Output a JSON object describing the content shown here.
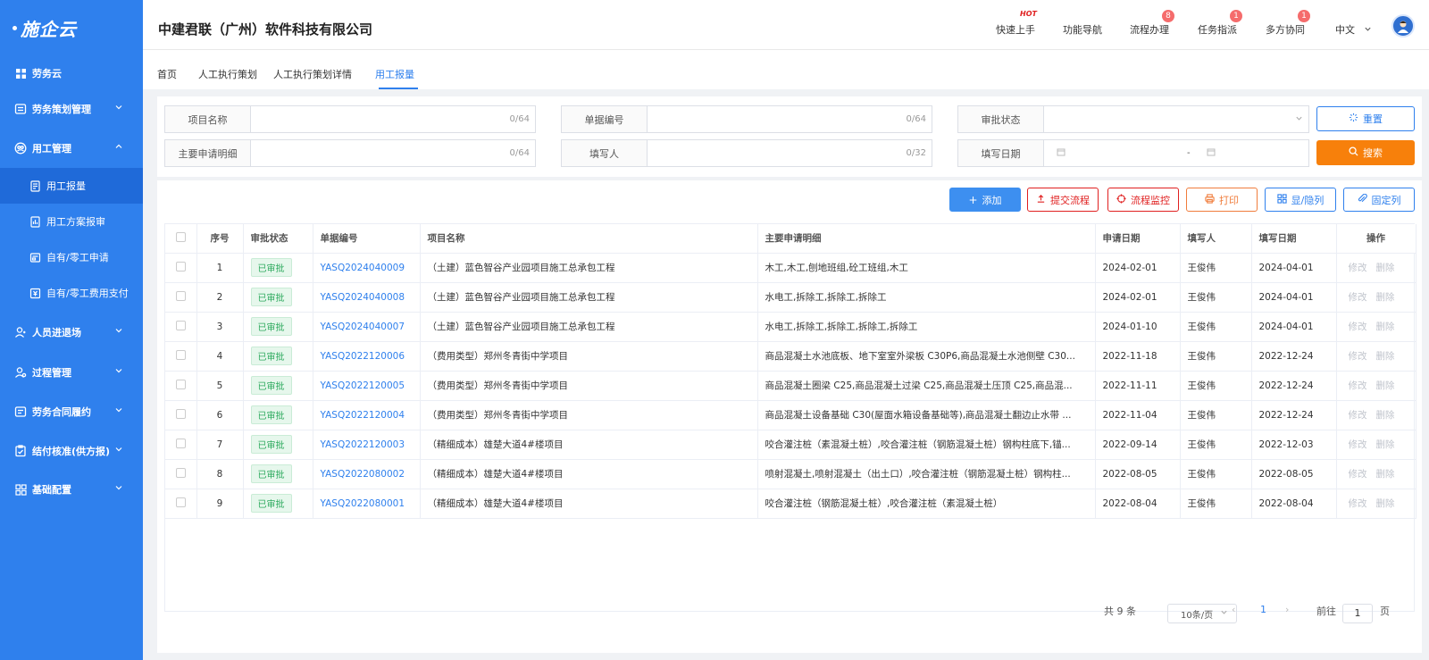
{
  "app": {
    "logo": "施企云"
  },
  "sidebar": {
    "items": [
      {
        "label": "劳务云"
      },
      {
        "label": "劳务策划管理"
      },
      {
        "label": "用工管理"
      },
      {
        "label": "用工报量"
      },
      {
        "label": "用工方案报审"
      },
      {
        "label": "自有/零工申请"
      },
      {
        "label": "自有/零工费用支付"
      },
      {
        "label": "人员进退场"
      },
      {
        "label": "过程管理"
      },
      {
        "label": "劳务合同履约"
      },
      {
        "label": "结付核准(供方报)"
      },
      {
        "label": "基础配置"
      }
    ]
  },
  "header": {
    "company": "中建君联（广州）软件科技有限公司",
    "nav": [
      {
        "label": "快速上手",
        "hot": "HOT"
      },
      {
        "label": "功能导航"
      },
      {
        "label": "流程办理",
        "badge": "8"
      },
      {
        "label": "任务指派",
        "badge": "1"
      },
      {
        "label": "多方协同",
        "badge": "1"
      }
    ],
    "language": "中文"
  },
  "tabs": [
    "首页",
    "人工执行策划",
    "人工执行策划详情",
    "用工报量"
  ],
  "filter": {
    "fields": [
      {
        "label": "项目名称",
        "counter": "0/64"
      },
      {
        "label": "单据编号",
        "counter": "0/64"
      },
      {
        "label": "审批状态",
        "counter": ""
      },
      {
        "label": "主要申请明细",
        "counter": "0/64"
      },
      {
        "label": "填写人",
        "counter": "0/32"
      },
      {
        "label": "填写日期",
        "counter": ""
      }
    ],
    "date_separator": "-",
    "reset_label": "重置",
    "search_label": "搜索"
  },
  "toolbar": {
    "add": "添加",
    "submit": "提交流程",
    "monitor": "流程监控",
    "print": "打印",
    "toggle": "显/隐列",
    "fix": "固定列"
  },
  "table": {
    "columns": [
      "",
      "序号",
      "审批状态",
      "单据编号",
      "项目名称",
      "主要申请明细",
      "申请日期",
      "填写人",
      "填写日期",
      "操作"
    ],
    "rows": [
      {
        "no": "1",
        "status": "已审批",
        "code": "YASQ2024040009",
        "project": "（土建）蓝色智谷产业园项目施工总承包工程",
        "detail": "木工,木工,刨地班组,砼工班组,木工",
        "apply_date": "2024-02-01",
        "user": "王俊伟",
        "fill_date": "2024-04-01"
      },
      {
        "no": "2",
        "status": "已审批",
        "code": "YASQ2024040008",
        "project": "（土建）蓝色智谷产业园项目施工总承包工程",
        "detail": "水电工,拆除工,拆除工,拆除工",
        "apply_date": "2024-02-01",
        "user": "王俊伟",
        "fill_date": "2024-04-01"
      },
      {
        "no": "3",
        "status": "已审批",
        "code": "YASQ2024040007",
        "project": "（土建）蓝色智谷产业园项目施工总承包工程",
        "detail": "水电工,拆除工,拆除工,拆除工,拆除工",
        "apply_date": "2024-01-10",
        "user": "王俊伟",
        "fill_date": "2024-04-01"
      },
      {
        "no": "4",
        "status": "已审批",
        "code": "YASQ2022120006",
        "project": "（费用类型）郑州冬青街中学项目",
        "detail": "商品混凝土水池底板、地下室室外梁板 C30P6,商品混凝土水池侧壁 C30...",
        "apply_date": "2022-11-18",
        "user": "王俊伟",
        "fill_date": "2022-12-24"
      },
      {
        "no": "5",
        "status": "已审批",
        "code": "YASQ2022120005",
        "project": "（费用类型）郑州冬青街中学项目",
        "detail": "商品混凝土圈梁 C25,商品混凝土过梁 C25,商品混凝土压顶 C25,商品混...",
        "apply_date": "2022-11-11",
        "user": "王俊伟",
        "fill_date": "2022-12-24"
      },
      {
        "no": "6",
        "status": "已审批",
        "code": "YASQ2022120004",
        "project": "（费用类型）郑州冬青街中学项目",
        "detail": "商品混凝土设备基础 C30(屋面水箱设备基础等),商品混凝土翻边止水带 ...",
        "apply_date": "2022-11-04",
        "user": "王俊伟",
        "fill_date": "2022-12-24"
      },
      {
        "no": "7",
        "status": "已审批",
        "code": "YASQ2022120003",
        "project": "（精细成本）雄楚大道4#楼项目",
        "detail": "咬合灌注桩（素混凝土桩）,咬合灌注桩（钢筋混凝土桩）钢构柱底下,锚...",
        "apply_date": "2022-09-14",
        "user": "王俊伟",
        "fill_date": "2022-12-03"
      },
      {
        "no": "8",
        "status": "已审批",
        "code": "YASQ2022080002",
        "project": "（精细成本）雄楚大道4#楼项目",
        "detail": "喷射混凝土,喷射混凝土（出土口）,咬合灌注桩（钢筋混凝土桩）钢构柱...",
        "apply_date": "2022-08-05",
        "user": "王俊伟",
        "fill_date": "2022-08-05"
      },
      {
        "no": "9",
        "status": "已审批",
        "code": "YASQ2022080001",
        "project": "（精细成本）雄楚大道4#楼项目",
        "detail": "咬合灌注桩（钢筋混凝土桩）,咬合灌注桩（素混凝土桩）",
        "apply_date": "2022-08-04",
        "user": "王俊伟",
        "fill_date": "2022-08-04"
      }
    ],
    "ops": {
      "edit": "修改",
      "delete": "删除"
    }
  },
  "pagination": {
    "total": "共 9 条",
    "page_size": "10条/页",
    "current": "1",
    "goto_prefix": "前往",
    "goto_value": "1",
    "goto_suffix": "页"
  },
  "colors": {
    "primary": "#2f80ed",
    "orange": "#f7800b",
    "red": "#e02020",
    "green": "#2daa5e"
  }
}
